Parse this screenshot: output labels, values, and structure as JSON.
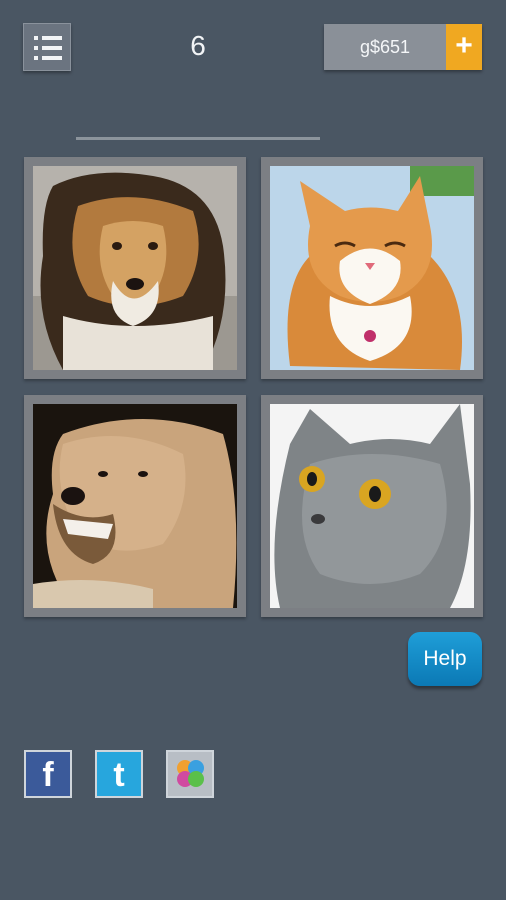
{
  "header": {
    "level": "6",
    "coins": "g$651",
    "add_coins_label": "+"
  },
  "tiles": [
    {
      "name": "dog-image-1",
      "subject": "dog"
    },
    {
      "name": "cat-image-1",
      "subject": "cat"
    },
    {
      "name": "dog-image-2",
      "subject": "dog"
    },
    {
      "name": "cat-image-2",
      "subject": "cat"
    }
  ],
  "help": {
    "label": "Help"
  },
  "social": {
    "facebook_glyph": "f",
    "twitter_glyph": "t"
  }
}
